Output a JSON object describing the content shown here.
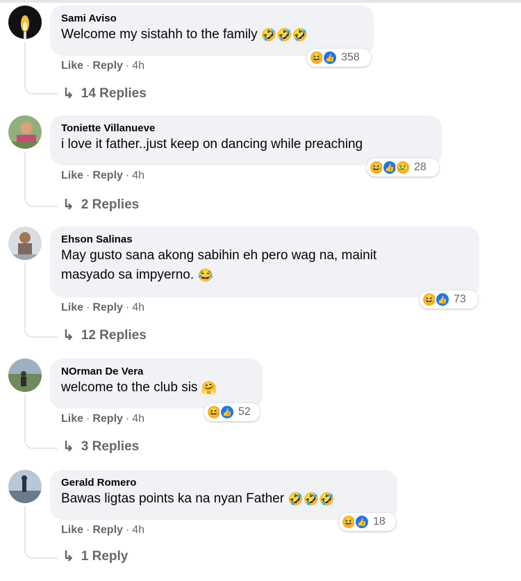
{
  "comments": [
    {
      "author": "Sami Aviso",
      "text": "Welcome my sistahh to the family",
      "emojis": "🤣🤣🤣",
      "reactions": [
        "haha",
        "like"
      ],
      "reaction_count": "358",
      "like_label": "Like",
      "reply_label": "Reply",
      "time": "4h",
      "replies_label": "14 Replies"
    },
    {
      "author": "Toniette Villanueve",
      "text": "i love it father..just keep on dancing while preaching",
      "emojis": "",
      "reactions": [
        "haha",
        "like",
        "sad"
      ],
      "reaction_count": "28",
      "like_label": "Like",
      "reply_label": "Reply",
      "time": "4h",
      "replies_label": "2 Replies"
    },
    {
      "author": "Ehson Salinas",
      "text": "May gusto sana akong sabihin eh pero wag na, mainit\nmasyado sa impyerno.",
      "emojis": "😂",
      "reactions": [
        "haha",
        "like"
      ],
      "reaction_count": "73",
      "like_label": "Like",
      "reply_label": "Reply",
      "time": "4h",
      "replies_label": "12 Replies"
    },
    {
      "author": "NOrman De Vera",
      "text": "welcome to the club sis",
      "emojis": "🤗",
      "reactions": [
        "haha",
        "like"
      ],
      "reaction_count": "52",
      "like_label": "Like",
      "reply_label": "Reply",
      "time": "4h",
      "replies_label": "3 Replies"
    },
    {
      "author": "Gerald Romero",
      "text": "Bawas ligtas points ka na nyan Father",
      "emojis": "🤣🤣🤣",
      "reactions": [
        "haha",
        "like"
      ],
      "reaction_count": "18",
      "like_label": "Like",
      "reply_label": "Reply",
      "time": "4h",
      "replies_label": "1 Reply"
    }
  ],
  "colors": {
    "bubble": "#f0f2f5",
    "secondary_text": "#65676b",
    "like_blue": "#1877f2",
    "haha_yellow": "#f7b125"
  }
}
